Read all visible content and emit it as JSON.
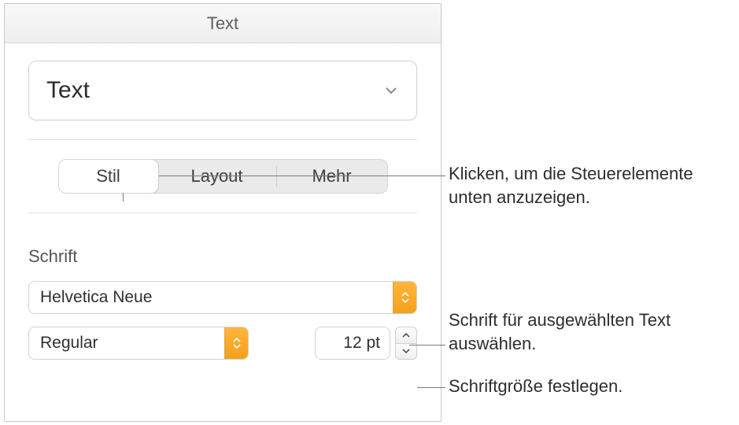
{
  "panel": {
    "header": "Text",
    "style_select": {
      "label": "Text"
    },
    "tabs": {
      "stil": "Stil",
      "layout": "Layout",
      "mehr": "Mehr"
    },
    "schrift": {
      "label": "Schrift",
      "font_family": "Helvetica Neue",
      "font_weight": "Regular",
      "size": "12 pt"
    }
  },
  "callouts": {
    "tabs": "Klicken, um die Steuerelemente unten anzuzeigen.",
    "font": "Schrift für ausgewählten Text auswählen.",
    "size": "Schriftgröße festlegen."
  },
  "colors": {
    "accent": "#f5a623"
  }
}
